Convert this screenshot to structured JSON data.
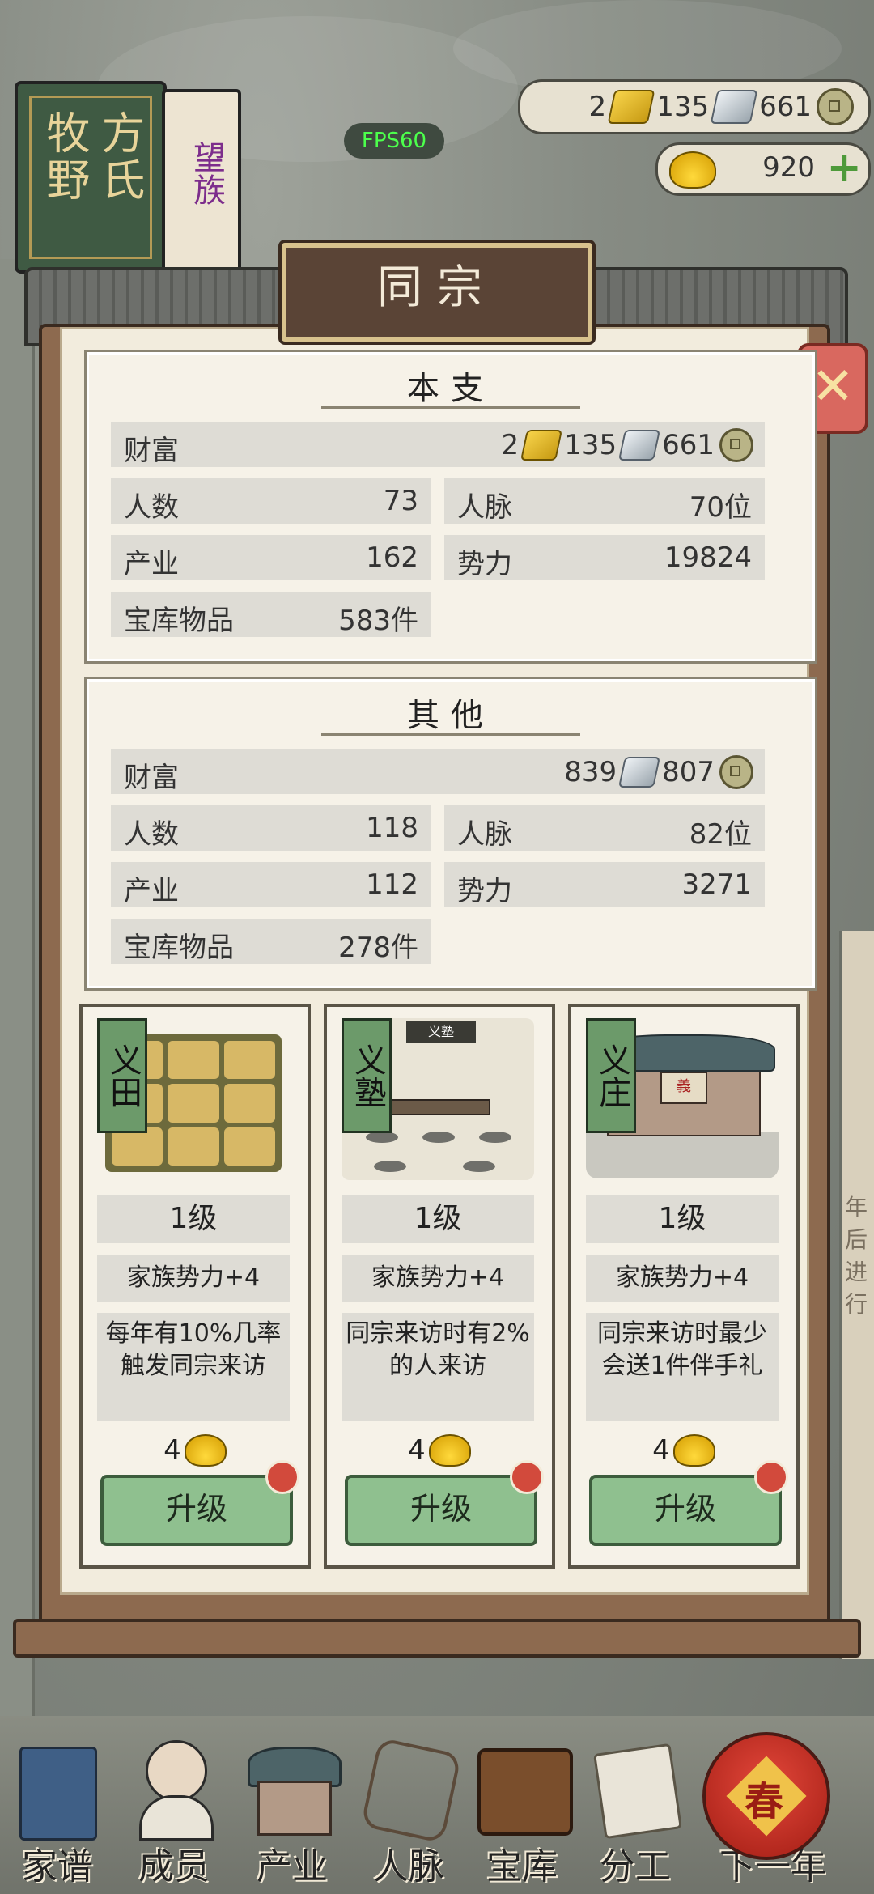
{
  "topbar": {
    "book_main": "牧野方氏",
    "book_back": "望族",
    "fps": "FPS60",
    "currency": {
      "gold": "2",
      "silver": "135",
      "copper": "661"
    },
    "ingot": "920"
  },
  "dialog": {
    "title": "同宗",
    "close_icon": "close-icon"
  },
  "main_branch": {
    "title": "本支",
    "wealth_label": "财富",
    "wealth_gold": "2",
    "wealth_silver": "135",
    "wealth_copper": "661",
    "people_label": "人数",
    "people": "73",
    "network_label": "人脉",
    "network": "70位",
    "industry_label": "产业",
    "industry": "162",
    "power_label": "势力",
    "power": "19824",
    "vault_label": "宝库物品",
    "vault": "583件"
  },
  "other_branch": {
    "title": "其他",
    "wealth_label": "财富",
    "wealth_silver": "839",
    "wealth_copper": "807",
    "people_label": "人数",
    "people": "118",
    "network_label": "人脉",
    "network": "82位",
    "industry_label": "产业",
    "industry": "112",
    "power_label": "势力",
    "power": "3271",
    "vault_label": "宝库物品",
    "vault": "278件"
  },
  "buildings": [
    {
      "tag": "义田",
      "level": "1级",
      "buff": "家族势力+4",
      "desc": "每年有10%几率触发同宗来访",
      "cost": "4",
      "button": "升级"
    },
    {
      "tag": "义塾",
      "level": "1级",
      "buff": "家族势力+4",
      "desc": "同宗来访时有2%的人来访",
      "cost": "4",
      "button": "升级",
      "board": "义塾"
    },
    {
      "tag": "义庄",
      "level": "1级",
      "buff": "家族势力+4",
      "desc": "同宗来访时最少会送1件伴手礼",
      "cost": "4",
      "button": "升级",
      "door": "義"
    }
  ],
  "bottom_nav": [
    {
      "label": "家谱",
      "icon": "book-icon"
    },
    {
      "label": "成员",
      "icon": "person-icon"
    },
    {
      "label": "产业",
      "icon": "building-icon"
    },
    {
      "label": "人脉",
      "icon": "network-icon"
    },
    {
      "label": "宝库",
      "icon": "chest-icon"
    },
    {
      "label": "分工",
      "icon": "scroll-icon"
    },
    {
      "label": "下一年",
      "icon": "lantern-icon"
    }
  ],
  "lantern_char": "春",
  "colors": {
    "accent_green": "#8fc08f",
    "dialog_brown": "#5a4436",
    "paper": "#f2ecdd",
    "badge_red": "#d24a3c"
  }
}
